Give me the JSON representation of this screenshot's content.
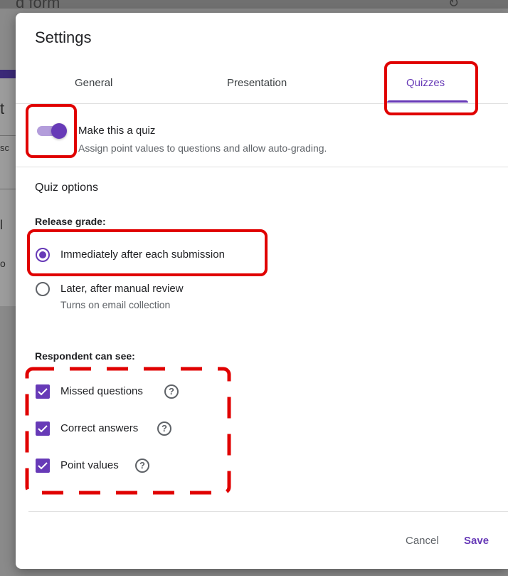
{
  "background": {
    "title_fragment": "d form",
    "frag_1": "t",
    "frag_2": "sc",
    "frag_3": "l",
    "frag_4": "o"
  },
  "dialog": {
    "title": "Settings",
    "tabs": [
      {
        "label": "General",
        "active": false
      },
      {
        "label": "Presentation",
        "active": false
      },
      {
        "label": "Quizzes",
        "active": true
      }
    ]
  },
  "quiz_toggle": {
    "on": true,
    "title": "Make this a quiz",
    "subtitle": "Assign point values to questions and allow auto-grading."
  },
  "quiz_options": {
    "heading": "Quiz options",
    "release_grade": {
      "label": "Release grade:",
      "options": [
        {
          "label": "Immediately after each submission",
          "selected": true,
          "sub": ""
        },
        {
          "label": "Later, after manual review",
          "selected": false,
          "sub": "Turns on email collection"
        }
      ]
    },
    "respondent_can_see": {
      "label": "Respondent can see:",
      "items": [
        {
          "label": "Missed questions",
          "checked": true,
          "help_icon": "?"
        },
        {
          "label": "Correct answers",
          "checked": true,
          "help_icon": "?"
        },
        {
          "label": "Point values",
          "checked": true,
          "help_icon": "?"
        }
      ]
    }
  },
  "footer": {
    "cancel_label": "Cancel",
    "save_label": "Save"
  },
  "colors": {
    "accent": "#673ab7",
    "annotation": "#e00000"
  }
}
